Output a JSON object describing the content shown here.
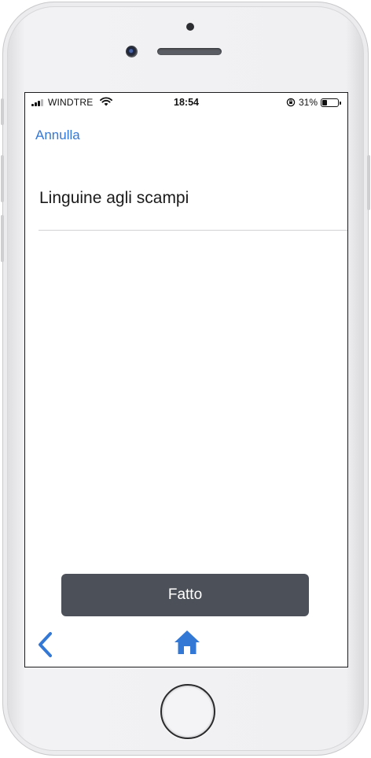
{
  "status_bar": {
    "carrier": "WINDTRE",
    "time": "18:54",
    "battery_percent_label": "31%",
    "battery_level": 0.31,
    "icons": [
      "signal-icon",
      "wifi-icon",
      "orientation-lock-icon",
      "battery-icon"
    ]
  },
  "header": {
    "cancel_label": "Annulla"
  },
  "form": {
    "text_value": "Linguine agli scampi"
  },
  "actions": {
    "done_label": "Fatto"
  },
  "bottom_nav": {
    "back_icon": "chevron-left-icon",
    "home_icon": "home-icon"
  },
  "colors": {
    "accent": "#3478d6",
    "button_bg": "#4c5159",
    "button_text": "#ffffff"
  }
}
